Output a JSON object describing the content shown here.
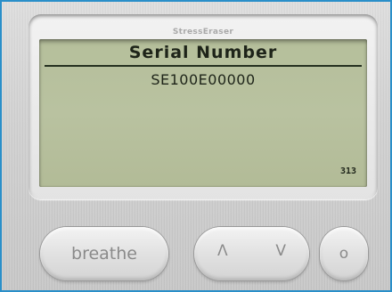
{
  "device": {
    "brand": "StressEraser"
  },
  "screen": {
    "title": "Serial Number",
    "serial": "SE100E00000",
    "code": "313"
  },
  "buttons": {
    "breathe_label": "breathe",
    "up_label": "Λ",
    "down_label": "V",
    "select_label": "o"
  },
  "colors": {
    "frame_border": "#2a8fc9",
    "lcd_background": "#b7c09d",
    "lcd_text": "#1e2419",
    "button_text": "#8a8a8a"
  }
}
